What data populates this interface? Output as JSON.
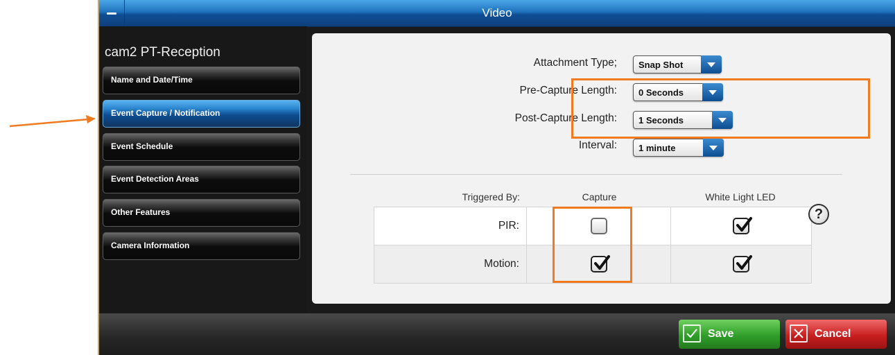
{
  "window": {
    "title": "Video"
  },
  "sidebar": {
    "camera_name": "cam2 PT-Reception",
    "items": [
      {
        "label": "Name and Date/Time"
      },
      {
        "label": "Event Capture / Notification",
        "active": true
      },
      {
        "label": "Event Schedule"
      },
      {
        "label": "Event Detection Areas"
      },
      {
        "label": "Other Features"
      },
      {
        "label": "Camera Information"
      }
    ]
  },
  "settings": {
    "attachment_type": {
      "label": "Attachment Type;",
      "value": "Snap Shot"
    },
    "pre_capture": {
      "label": "Pre-Capture Length:",
      "value": "0 Seconds"
    },
    "post_capture": {
      "label": "Post-Capture Length:",
      "value": "1 Seconds"
    },
    "interval": {
      "label": "Interval:",
      "value": "1 minute"
    }
  },
  "triggers": {
    "headers": {
      "triggered_by": "Triggered By:",
      "capture": "Capture",
      "led": "White Light LED"
    },
    "rows": [
      {
        "label": "PIR:",
        "capture": false,
        "led": true
      },
      {
        "label": "Motion:",
        "capture": true,
        "led": true
      }
    ],
    "help_icon": "question-circle-icon"
  },
  "footer": {
    "save_label": "Save",
    "cancel_label": "Cancel"
  },
  "colors": {
    "accent": "#1f73bd",
    "highlight": "#f07a1f",
    "save": "#2f9e29",
    "cancel": "#c81f1f"
  }
}
